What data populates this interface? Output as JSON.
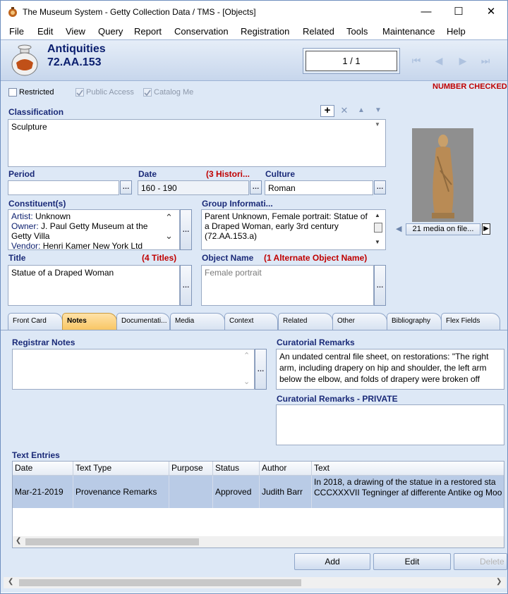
{
  "window": {
    "title": "The Museum System - Getty Collection Data / TMS - [Objects]",
    "minimize": "—",
    "maximize": "☐",
    "close": "✕"
  },
  "menu": [
    "File",
    "Edit",
    "View",
    "Query",
    "Report",
    "Conservation",
    "Registration",
    "Related",
    "Tools",
    "Maintenance",
    "Help"
  ],
  "header": {
    "department": "Antiquities",
    "object_number": "72.AA.153",
    "record_position": "1 / 1"
  },
  "flags": {
    "restricted": "Restricted",
    "public_access": "Public Access",
    "catalog_me": "Catalog Me",
    "status": "NUMBER CHECKED"
  },
  "classification": {
    "label": "Classification",
    "value": "Sculpture"
  },
  "media": {
    "count": "21 media on file..."
  },
  "period": {
    "label": "Period",
    "value": ""
  },
  "date": {
    "label": "Date",
    "value": "160 - 190",
    "historic": "(3 Histori..."
  },
  "culture": {
    "label": "Culture",
    "value": "Roman"
  },
  "constituents": {
    "label": "Constituent(s)",
    "lines": [
      {
        "role": "Artist:",
        "name": " Unknown"
      },
      {
        "role": "Owner:",
        "name": " J. Paul Getty Museum at the Getty Villa"
      },
      {
        "role": "Vendor:",
        "name": " Henri Kamer New York Ltd"
      }
    ]
  },
  "group_info": {
    "label": "Group Informati...",
    "text": "Parent Unknown, Female portrait: Statue of a Draped Woman, early 3rd century (72.AA.153.a)"
  },
  "title_field": {
    "label": "Title",
    "count": "(4 Titles)",
    "value": "Statue of a Draped Woman"
  },
  "object_name": {
    "label": "Object Name",
    "alternates": "(1 Alternate Object Name)",
    "value": "Female portrait"
  },
  "tabs": [
    "Front Card",
    "Notes",
    "Documentati...",
    "Media",
    "Context",
    "Related",
    "Other",
    "Bibliography",
    "Flex Fields"
  ],
  "notes": {
    "registrar_label": "Registrar Notes",
    "registrar_value": "",
    "curatorial_label": "Curatorial Remarks",
    "curatorial_value": "An undated central file sheet, on restorations: \"The right arm, including drapery on hip and shoulder, the left arm below the elbow, and folds of drapery were broken off",
    "private_label": "Curatorial Remarks - PRIVATE",
    "private_value": ""
  },
  "text_entries": {
    "label": "Text Entries",
    "columns": [
      "Date",
      "Text Type",
      "Purpose",
      "Status",
      "Author",
      "Text"
    ],
    "rows": [
      {
        "date": "Mar-21-2019",
        "text_type": "Provenance Remarks",
        "purpose": "",
        "status": "Approved",
        "author": "Judith Barr",
        "text": "In 2018, a drawing of the statue in a restored sta CCCXXXVII Tegninger af differente Antike og Moo"
      }
    ]
  },
  "buttons": {
    "add": "Add",
    "edit": "Edit",
    "delete": "Delete"
  },
  "colors": {
    "accent_label": "#1a2a78",
    "alert": "#c00000",
    "panel_bg": "#dde8f6",
    "selected_row": "#b9cbe6",
    "active_tab": "#f8c562"
  }
}
